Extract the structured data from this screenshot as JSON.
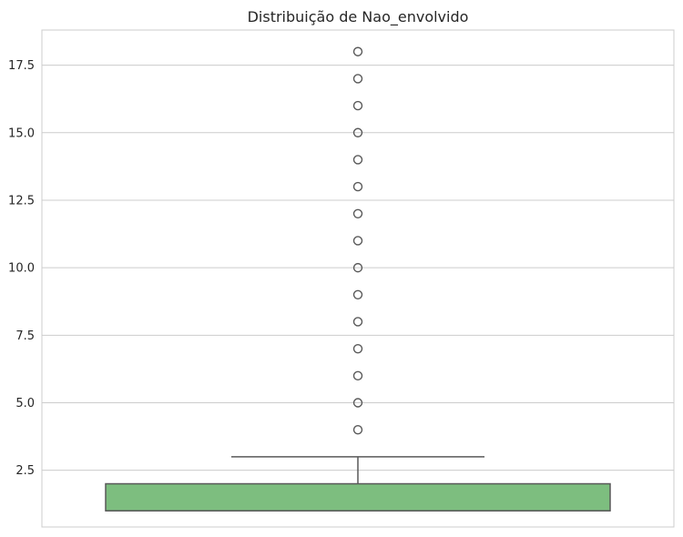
{
  "chart_data": {
    "type": "box",
    "title": "Distribuição de Nao_envolvido",
    "xlabel": "",
    "ylabel": "",
    "ylim": [
      0.4,
      18.8
    ],
    "yticks": [
      2.5,
      5.0,
      7.5,
      10.0,
      12.5,
      15.0,
      17.5
    ],
    "ytick_labels": [
      "2.5",
      "5.0",
      "7.5",
      "10.0",
      "12.5",
      "15.0",
      "17.5"
    ],
    "grid": "horizontal",
    "box": {
      "q1": 1,
      "median": 1,
      "q3": 2,
      "whisker_low": 1,
      "whisker_high": 3
    },
    "outliers": [
      4,
      5,
      6,
      7,
      8,
      9,
      10,
      11,
      12,
      13,
      14,
      15,
      16,
      17,
      18
    ],
    "colors": {
      "box_fill": "#7dbe7f",
      "box_edge": "#595959",
      "grid": "#cccccc",
      "axes_edge": "#cccccc",
      "text": "#262626"
    }
  }
}
